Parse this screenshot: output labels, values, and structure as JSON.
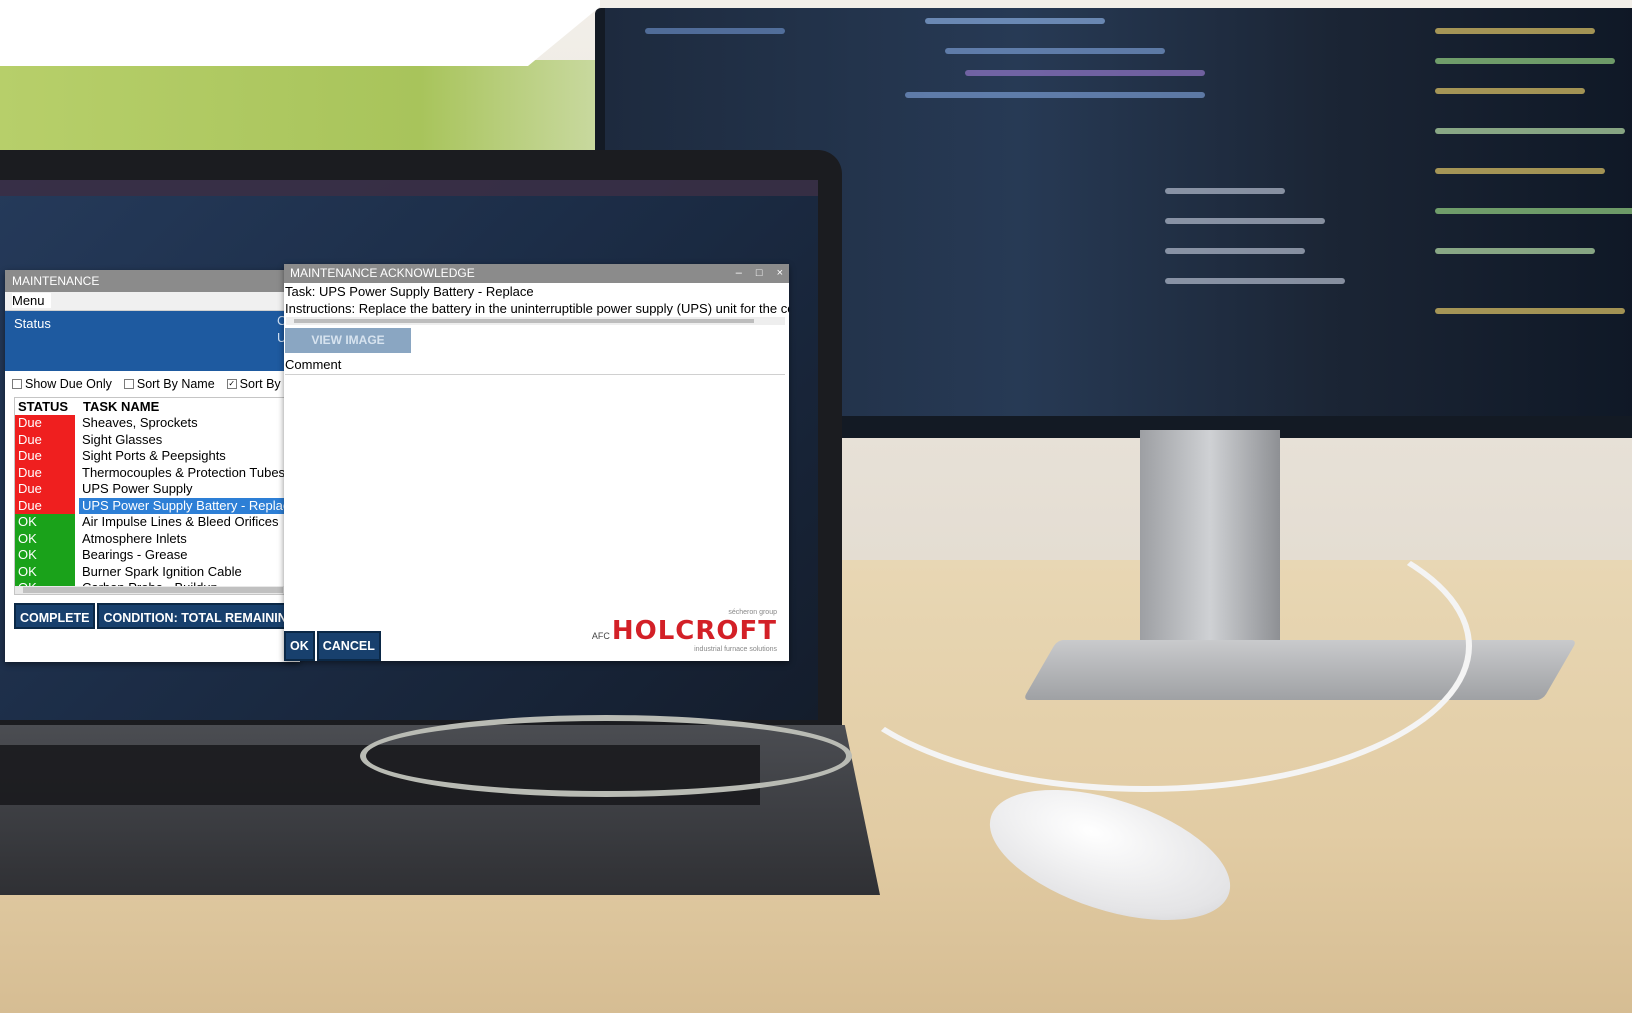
{
  "maintenance_window": {
    "title": "MAINTENANCE",
    "menu_label": "Menu",
    "status_label": "Status",
    "status_cut_1": "C",
    "status_cut_2": "U",
    "options": {
      "show_due_only": {
        "label": "Show Due Only",
        "checked": false
      },
      "sort_by_name": {
        "label": "Sort By Name",
        "checked": false
      },
      "sort_by_c": {
        "label": "Sort By C",
        "checked": true
      }
    },
    "list": {
      "headers": [
        "STATUS",
        "TASK NAME"
      ],
      "rows": [
        {
          "status": "Due",
          "name": "Sheaves, Sprockets"
        },
        {
          "status": "Due",
          "name": "Sight Glasses"
        },
        {
          "status": "Due",
          "name": "Sight Ports & Peepsights"
        },
        {
          "status": "Due",
          "name": "Thermocouples & Protection Tubes -"
        },
        {
          "status": "Due",
          "name": "UPS Power Supply"
        },
        {
          "status": "Due",
          "name": "UPS Power Supply Battery - Replace"
        },
        {
          "status": "OK",
          "name": "Air Impulse Lines & Bleed Orifices"
        },
        {
          "status": "OK",
          "name": "Atmosphere Inlets"
        },
        {
          "status": "OK",
          "name": "Bearings - Grease"
        },
        {
          "status": "OK",
          "name": "Burner Spark Ignition Cable"
        },
        {
          "status": "OK",
          "name": "Carbon Probe - Buildup"
        }
      ],
      "selected_index": 5
    },
    "buttons": {
      "complete": "COMPLETE",
      "condition": "CONDITION: TOTAL REMAINING"
    }
  },
  "ack_dialog": {
    "title": "MAINTENANCE ACKNOWLEDGE",
    "controls": {
      "minimize": "–",
      "maximize": "□",
      "close": "×"
    },
    "task_line": "Task: UPS Power Supply Battery - Replace",
    "instructions_line": "Instructions: Replace the battery in the uninterruptible power supply (UPS) unit for the com",
    "view_image_label": "VIEW IMAGE",
    "comment_label": "Comment",
    "comment_value": "",
    "ok_label": "OK",
    "cancel_label": "CANCEL",
    "logo": {
      "group": "sécheron group",
      "prefix": "AFC",
      "brand": "HOLCROFT",
      "tagline": "industrial furnace solutions"
    }
  },
  "colors": {
    "due": "#ef1f1f",
    "ok": "#1aa21a",
    "selected": "#2d7fd6",
    "status_panel": "#1e5aa0",
    "dark_button": "#18406d",
    "titlebar": "#8b8b8b",
    "brand_red": "#d32027"
  }
}
